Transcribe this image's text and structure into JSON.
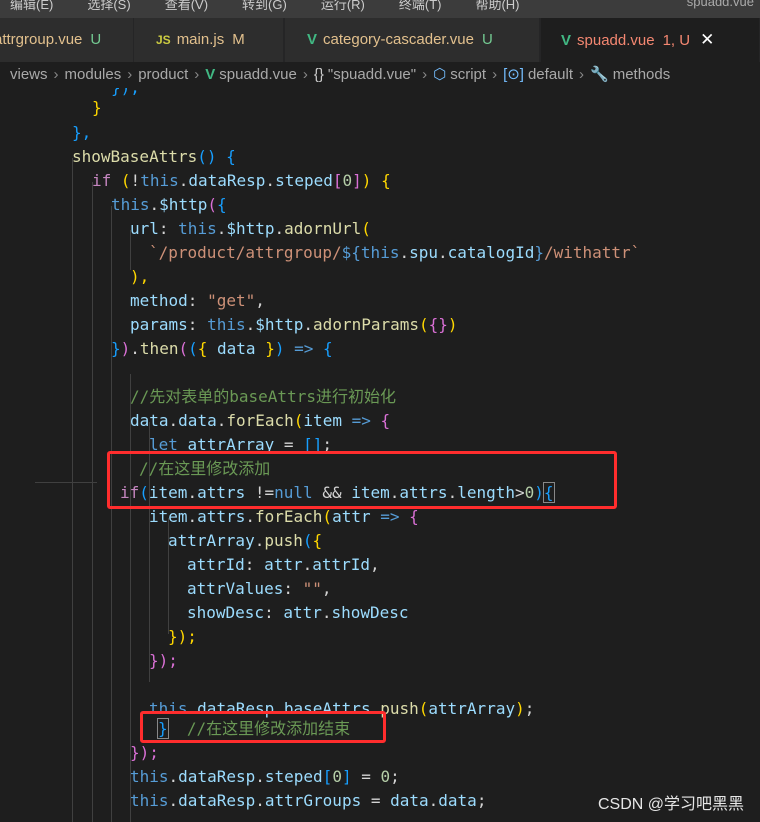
{
  "menubar": {
    "items": [
      "编辑(E)",
      "选择(S)",
      "查看(V)",
      "转到(G)",
      "运行(R)",
      "终端(T)",
      "帮助(H)"
    ],
    "window_title": "spuadd.vue"
  },
  "tabs": [
    {
      "label": "attrgroup.vue",
      "status": "U",
      "icon": "vue-icon"
    },
    {
      "label": "main.js",
      "status": "M",
      "icon": "js-icon",
      "icon_text": "JS"
    },
    {
      "label": "category-cascader.vue",
      "status": "U",
      "icon": "vue-icon"
    },
    {
      "label": "spuadd.vue",
      "status": "1, U",
      "icon": "vue-icon",
      "active": true,
      "close": "✕"
    }
  ],
  "breadcrumb": {
    "views": "views",
    "modules": "modules",
    "product": "product",
    "file": "spuadd.vue",
    "file_scope": "\"spuadd.vue\"",
    "script": "script",
    "default": "default",
    "methods": "methods"
  },
  "code": {
    "l1": "});",
    "l2": "}",
    "l3": "},",
    "l4_fn": "showBaseAttrs",
    "l5_data": "dataResp",
    "l5_steped": "steped",
    "l5_idx": "0",
    "l6_http": "$http",
    "l7_url": "url",
    "l7_http": "$http",
    "l7_fn": "adornUrl",
    "l8_str1": "`/product/attrgroup/",
    "l8_spu": "spu",
    "l8_cat": "catalogId",
    "l8_str2": "/withattr`",
    "l9": "),",
    "l10_key": "method",
    "l10_val": "\"get\"",
    "l11_key": "params",
    "l11_http": "$http",
    "l11_fn": "adornParams",
    "l12_then": "then",
    "l12_data": "data",
    "l14_comment": "//先对表单的baseAttrs进行初始化",
    "l15_data1": "data",
    "l15_data2": "data",
    "l15_fn": "forEach",
    "l15_item": "item",
    "l16_var": "attrArray",
    "l17_comment": "//在这里修改添加",
    "l18_item": "item",
    "l18_attrs": "attrs",
    "l18_null": "null",
    "l18_item2": "item",
    "l18_attrs2": "attrs",
    "l18_len": "length",
    "l18_num": "0",
    "l19_item": "item",
    "l19_attrs": "attrs",
    "l19_fn": "forEach",
    "l19_attr": "attr",
    "l20_arr": "attrArray",
    "l20_fn": "push",
    "l21_key": "attrId",
    "l21_attr": "attr",
    "l21_prop": "attrId",
    "l22_key": "attrValues",
    "l22_val": "\"\"",
    "l23_key": "showDesc",
    "l23_attr": "attr",
    "l23_prop": "showDesc",
    "l24": "});",
    "l25": "});",
    "l27_resp": "dataResp",
    "l27_base": "baseAttrs",
    "l27_fn": "push",
    "l27_arr": "attrArray",
    "l28_comment": "//在这里修改添加结束",
    "l29": "});",
    "l30_resp": "dataResp",
    "l30_steped": "steped",
    "l30_idx": "0",
    "l30_val": "0",
    "l31_resp": "dataResp",
    "l31_groups": "attrGroups",
    "l31_data1": "data",
    "l31_data2": "data"
  },
  "colors": {
    "highlight_box": "#ff2d2d"
  },
  "watermark": "CSDN @学习吧黑黑"
}
